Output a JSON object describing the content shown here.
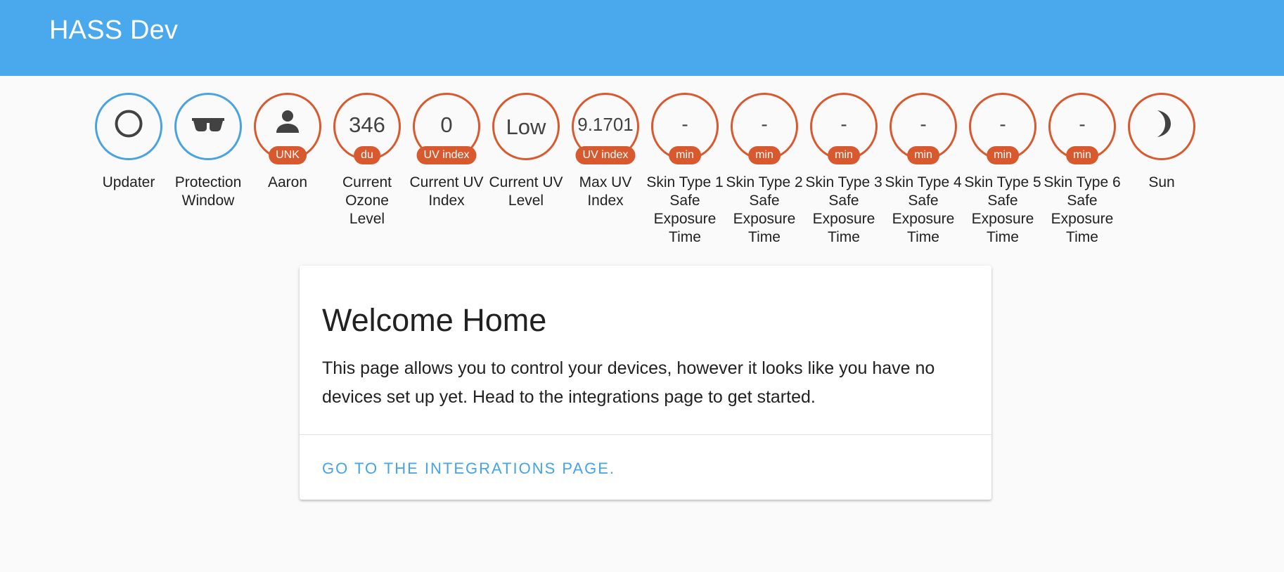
{
  "header": {
    "title": "HASS Dev"
  },
  "badges": [
    {
      "label": "Updater",
      "icon": "circle-outline-icon",
      "ring": "#4aa3e0"
    },
    {
      "label": "Protection Window",
      "icon": "sunglasses-icon",
      "ring": "#4aa3e0"
    },
    {
      "label": "Aaron",
      "icon": "account-icon",
      "unit": "UNK",
      "ring": "#d9592f"
    },
    {
      "label": "Current Ozone Level",
      "value": "346",
      "unit": "du"
    },
    {
      "label": "Current UV Index",
      "value": "0",
      "unit": "UV index"
    },
    {
      "label": "Current UV Level",
      "value": "Low"
    },
    {
      "label": "Max UV Index",
      "value": "9.1701",
      "unit": "UV index"
    },
    {
      "label": "Skin Type 1 Safe Exposure Time",
      "value": "-",
      "unit": "min"
    },
    {
      "label": "Skin Type 2 Safe Exposure Time",
      "value": "-",
      "unit": "min"
    },
    {
      "label": "Skin Type 3 Safe Exposure Time",
      "value": "-",
      "unit": "min"
    },
    {
      "label": "Skin Type 4 Safe Exposure Time",
      "value": "-",
      "unit": "min"
    },
    {
      "label": "Skin Type 5 Safe Exposure Time",
      "value": "-",
      "unit": "min"
    },
    {
      "label": "Skin Type 6 Safe Exposure Time",
      "value": "-",
      "unit": "min"
    },
    {
      "label": "Sun",
      "icon": "moon-icon",
      "ring": "#d9592f"
    }
  ],
  "welcome_card": {
    "title": "Welcome Home",
    "body": "This page allows you to control your devices, however it looks like you have no devices set up yet. Head to the integrations page to get started.",
    "action_label": "GO TO THE INTEGRATIONS PAGE."
  },
  "colors": {
    "header": "#4aa8ec",
    "badge_ring_orange": "#d9592f",
    "badge_ring_blue": "#4aa3e0",
    "action_link": "#45a3e6"
  }
}
